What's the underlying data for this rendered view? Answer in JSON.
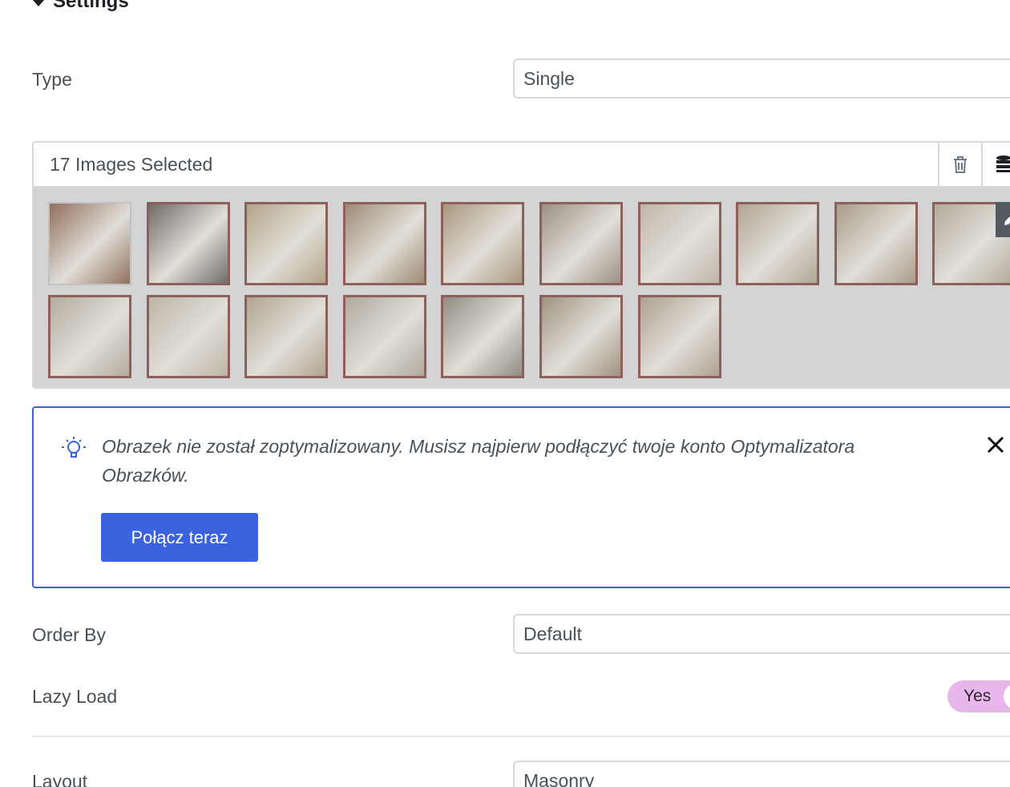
{
  "section": {
    "title": "Settings"
  },
  "type_row": {
    "label": "Type",
    "value": "Single"
  },
  "gallery": {
    "count_label": "17 Images Selected",
    "thumbnails": [
      "#7a4e34",
      "#4d4a44",
      "#a9956f",
      "#8c7355",
      "#9c8461",
      "#8a7a68",
      "#b8ad9c",
      "#a6977f",
      "#9b8a70",
      "#a89c88",
      "#a89e8d",
      "#b5aa97",
      "#a49478",
      "#a39a8b",
      "#7c7466",
      "#8d7c64",
      "#a1907a"
    ]
  },
  "notice": {
    "message": "Obrazek nie został zoptymalizowany. Musisz najpierw podłączyć twoje konto Optymalizatora Obrazków.",
    "button_label": "Połącz teraz"
  },
  "order_row": {
    "label": "Order By",
    "value": "Default"
  },
  "lazy_row": {
    "label": "Lazy Load",
    "toggle_label": "Yes"
  },
  "layout_row": {
    "label": "Layout",
    "value": "Masonry"
  },
  "colors": {
    "accent": "#3a63dd",
    "thumb_border": "#8f5f5b",
    "toggle_on": "#e8b5ec"
  }
}
